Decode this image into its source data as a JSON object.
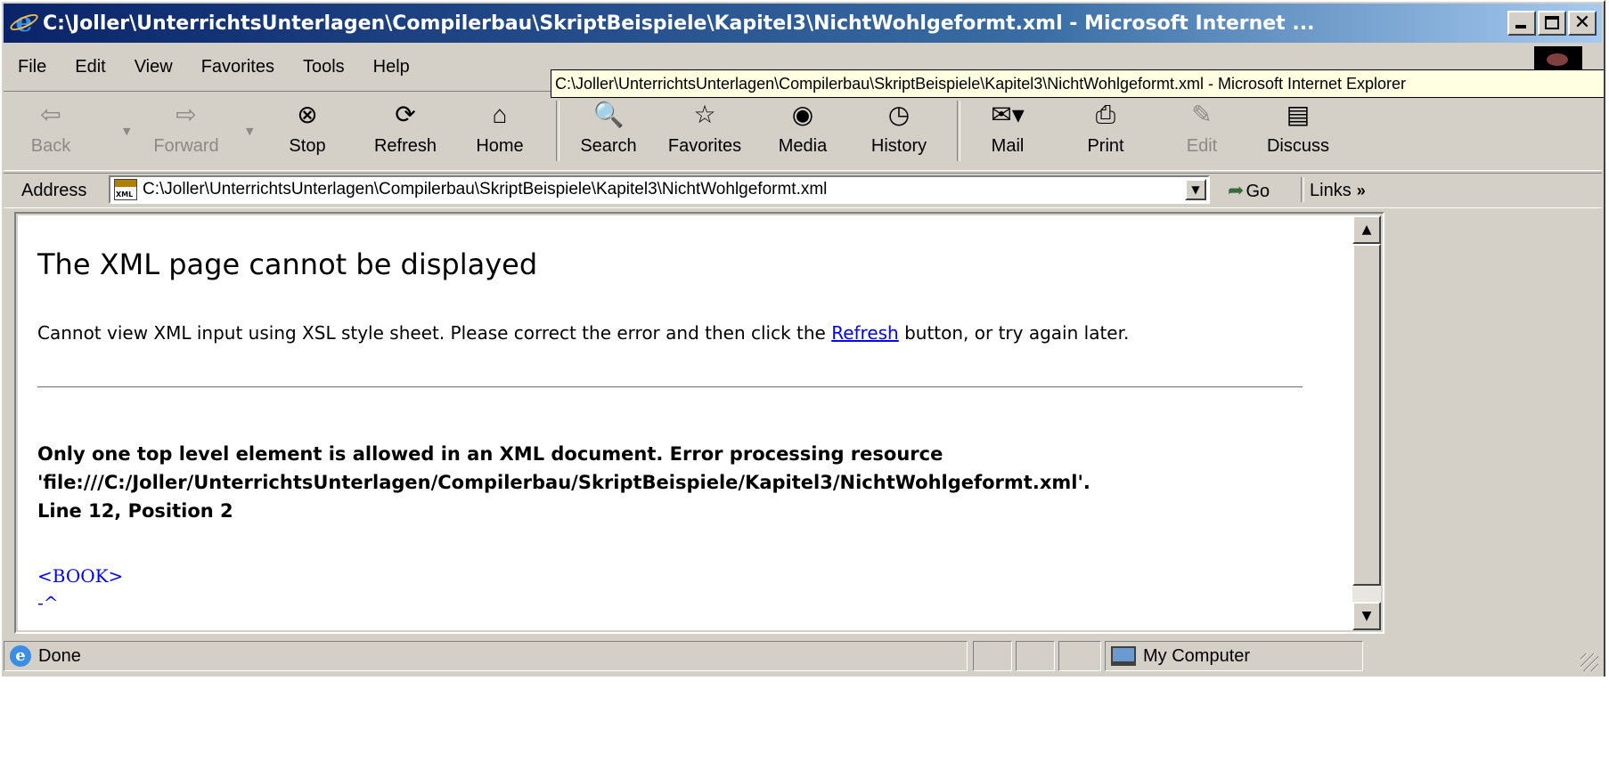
{
  "window": {
    "title": "C:\\Joller\\UnterrichtsUnterlagen\\Compilerbau\\SkriptBeispiele\\Kapitel3\\NichtWohlgeformt.xml - Microsoft Internet ..."
  },
  "menu": [
    {
      "label": "File"
    },
    {
      "label": "Edit"
    },
    {
      "label": "View"
    },
    {
      "label": "Favorites"
    },
    {
      "label": "Tools"
    },
    {
      "label": "Help"
    }
  ],
  "tooltip": "C:\\Joller\\UnterrichtsUnterlagen\\Compilerbau\\SkriptBeispiele\\Kapitel3\\NichtWohlgeformt.xml - Microsoft Internet Explorer",
  "toolbar": {
    "back": "Back",
    "forward": "Forward",
    "stop": "Stop",
    "refresh": "Refresh",
    "home": "Home",
    "search": "Search",
    "favorites": "Favorites",
    "media": "Media",
    "history": "History",
    "mail": "Mail",
    "print": "Print",
    "edit": "Edit",
    "discuss": "Discuss"
  },
  "address": {
    "label": "Address",
    "value": "C:\\Joller\\UnterrichtsUnterlagen\\Compilerbau\\SkriptBeispiele\\Kapitel3\\NichtWohlgeformt.xml",
    "go": "Go",
    "links": "Links"
  },
  "page": {
    "title": "The XML page cannot be displayed",
    "desc_before": "Cannot view XML input using XSL style sheet. Please correct the error and then click the ",
    "desc_link": "Refresh",
    "desc_after": " button, or try again later.",
    "error_line1": "Only one top level element is allowed in an XML document. Error processing resource",
    "error_line2": "'file:///C:/Joller/UnterrichtsUnterlagen/Compilerbau/SkriptBeispiele/Kapitel3/NichtWohlgeformt.xml'.",
    "error_line3": "Line 12, Position 2",
    "source_line": "<BOOK>",
    "caret_line": "-^"
  },
  "status": {
    "text": "Done",
    "zone": "My Computer"
  }
}
